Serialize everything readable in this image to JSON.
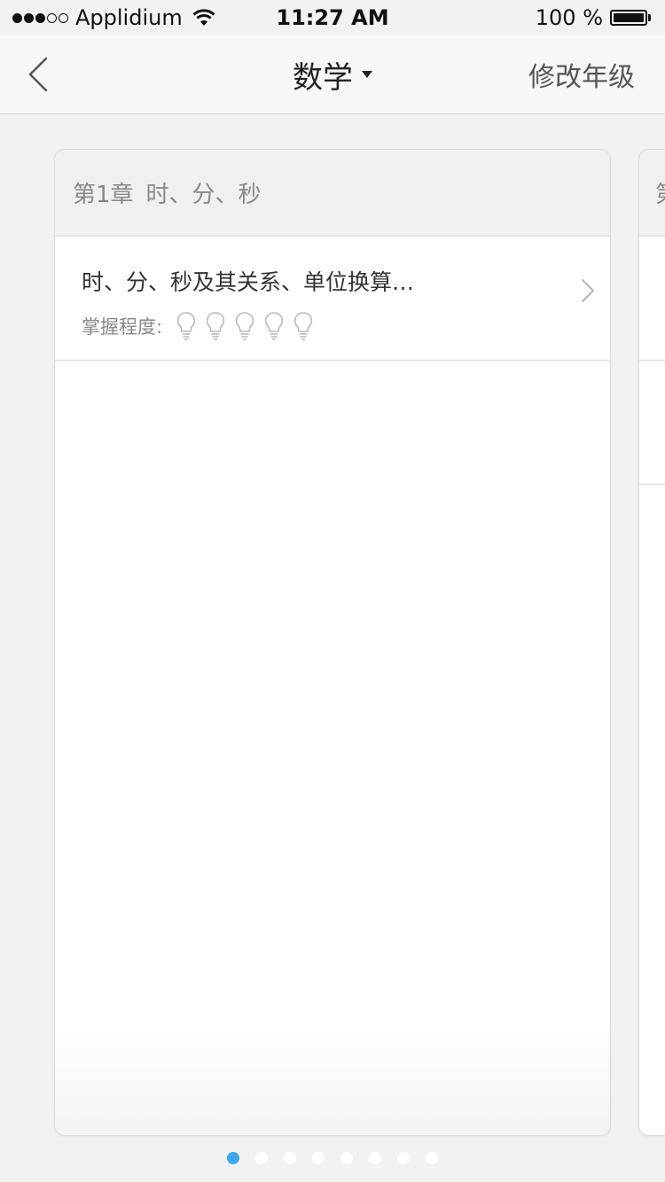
{
  "status": {
    "carrier": "Applidium",
    "time": "11:27 AM",
    "battery": "100 %",
    "signal_dots_on": 3,
    "signal_dots_total": 5
  },
  "nav": {
    "title": "数学",
    "right_action": "修改年级"
  },
  "card": {
    "chapter_num": "第1章",
    "chapter_title": "时、分、秒",
    "items": [
      {
        "title": "时、分、秒及其关系、单位换算…",
        "mastery_label": "掌握程度:",
        "mastery_level": 0,
        "mastery_max": 5
      }
    ]
  },
  "next_card": {
    "chapter_num_partial": "第"
  },
  "pager": {
    "total": 8,
    "active": 0
  },
  "colors": {
    "accent": "#3aa8f0",
    "background": "#f2f2f2",
    "header_bg": "#f0f0f0"
  }
}
